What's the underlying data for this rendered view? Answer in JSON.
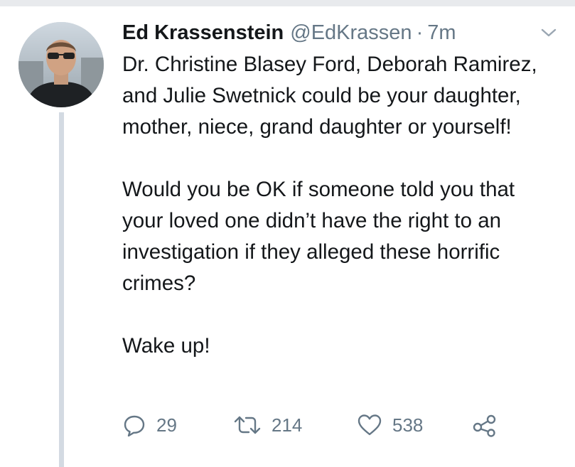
{
  "tweet": {
    "author": {
      "display_name": "Ed Krassenstein",
      "handle": "@EdKrassen",
      "separator": "·",
      "time": "7m"
    },
    "body": {
      "paragraph_1": "Dr. Christine Blasey Ford, Deborah Ramirez, and Julie Swetnick could be your daughter, mother, niece, grand daughter or yourself!",
      "paragraph_2": "Would you be OK if someone told you that your loved one didn’t have the right to an investigation if they alleged these horrific crimes?",
      "paragraph_3": "Wake up!"
    },
    "actions": {
      "reply": {
        "icon": "reply-icon",
        "count": "29"
      },
      "retweet": {
        "icon": "retweet-icon",
        "count": "214"
      },
      "like": {
        "icon": "heart-icon",
        "count": "538"
      },
      "share": {
        "icon": "share-icon"
      }
    },
    "menu": {
      "icon": "chevron-down-icon"
    }
  },
  "colors": {
    "text_primary": "#14171a",
    "text_secondary": "#657786",
    "thread_line": "#d3dae2",
    "background": "#ffffff"
  }
}
